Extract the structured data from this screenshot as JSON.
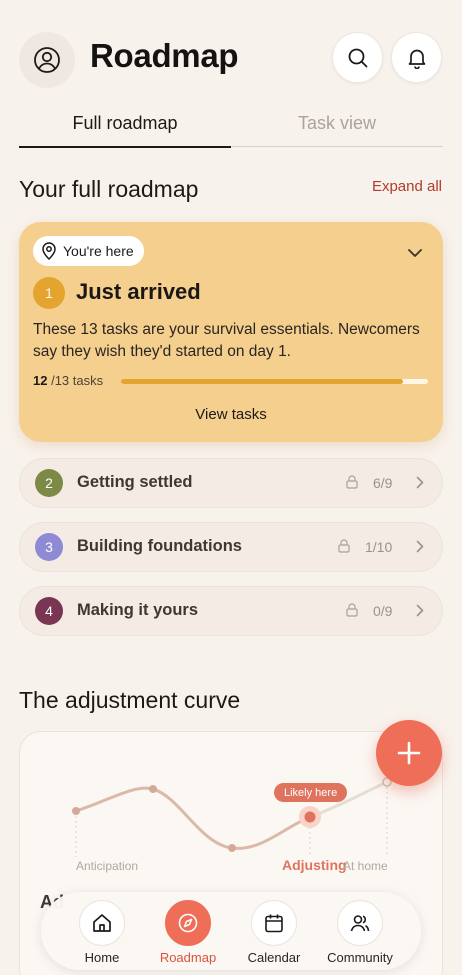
{
  "header": {
    "title": "Roadmap"
  },
  "tabs": [
    {
      "label": "Full roadmap",
      "active": true
    },
    {
      "label": "Task view",
      "active": false
    }
  ],
  "roadmap": {
    "section_title": "Your full roadmap",
    "expand_label": "Expand all",
    "current_stage": {
      "here_label": "You're here",
      "number": "1",
      "title": "Just arrived",
      "description": "These 13 tasks are your survival essentials. Newcomers say they wish they'd started on day 1.",
      "done": "12",
      "total_label": "/13 tasks",
      "progress": 0.92,
      "action_label": "View tasks"
    },
    "stages": [
      {
        "number": "2",
        "label": "Getting settled",
        "count": "6/9",
        "color": "#7d8a45"
      },
      {
        "number": "3",
        "label": "Building foundations",
        "count": "1/10",
        "color": "#8f8ad6"
      },
      {
        "number": "4",
        "label": "Making it yours",
        "count": "0/9",
        "color": "#7a3552"
      }
    ]
  },
  "curve": {
    "section_title": "The adjustment curve",
    "likely_label": "Likely here",
    "labels": {
      "anticipation": "Anticipation",
      "adjusting": "Adjusting",
      "at_home": "At home"
    },
    "partial_heading": "Ad"
  },
  "nav": {
    "items": [
      {
        "label": "Home",
        "icon": "home-icon",
        "active": false
      },
      {
        "label": "Roadmap",
        "icon": "compass-icon",
        "active": true
      },
      {
        "label": "Calendar",
        "icon": "calendar-icon",
        "active": false
      },
      {
        "label": "Community",
        "icon": "people-icon",
        "active": false
      }
    ]
  },
  "colors": {
    "background": "#f8f2ec",
    "accent": "#ee6e58",
    "stage_card": "#f5cf8e",
    "progress": "#e3a52f",
    "link": "#b23b2b"
  }
}
